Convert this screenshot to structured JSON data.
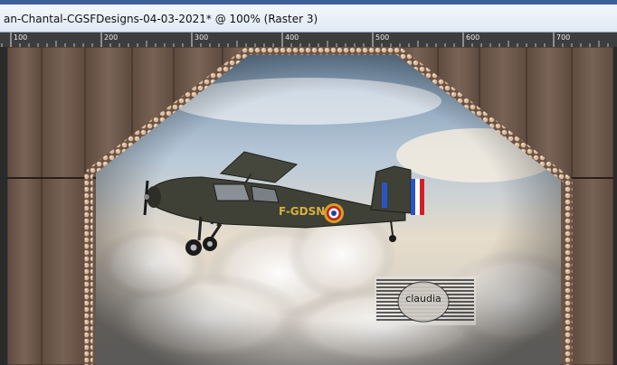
{
  "window": {
    "title": "an-Chantal-CGSFDesigns-04-03-2021* @ 100% (Raster 3)"
  },
  "ruler": {
    "ticks": [
      "100",
      "200",
      "300",
      "400",
      "500",
      "600",
      "700"
    ]
  },
  "artwork": {
    "plane_registration": "F-GDSN",
    "watermark": "claudia"
  },
  "colors": {
    "titlebar_accent": "#3c5f9a",
    "ruler_bg": "#3a3a3a",
    "wall_brown": "#6c5749",
    "sky_blue": "#b8c9d9"
  }
}
